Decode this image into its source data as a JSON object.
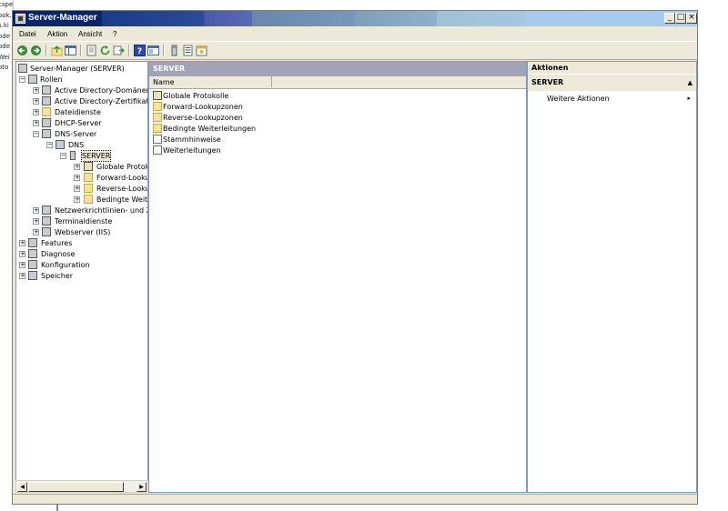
{
  "background": {
    "left_text_lines": [
      "cspeicherte Look",
      "ook.",
      "s.ki",
      "ode",
      "ode",
      "Wei",
      "oto"
    ]
  },
  "window": {
    "title": "Server-Manager",
    "buttons": {
      "minimize": "_",
      "maximize": "□",
      "close": "×"
    }
  },
  "menu": [
    "Datei",
    "Aktion",
    "Ansicht",
    "?"
  ],
  "toolbar": {
    "icons": [
      "back-icon",
      "forward-icon",
      "up-icon",
      "show-hide-tree-icon",
      "export-icon",
      "refresh-icon",
      "export-list-icon",
      "help-icon",
      "properties-icon",
      "server-icon",
      "list-icon",
      "calendar-icon"
    ]
  },
  "tree": {
    "items": [
      {
        "label": "Server-Manager (SERVER)",
        "icon": "server-manager-icon",
        "expander": ""
      },
      {
        "label": "Rollen",
        "icon": "roles-icon",
        "expander": "−"
      },
      {
        "label": "Active Directory-Domänendienste",
        "icon": "ad-icon",
        "expander": "+"
      },
      {
        "label": "Active Directory-Zertifikatdienste",
        "icon": "ad-cert-icon",
        "expander": "+"
      },
      {
        "label": "Dateidienste",
        "icon": "file-services-icon",
        "expander": "+"
      },
      {
        "label": "DHCP-Server",
        "icon": "dhcp-icon",
        "expander": "+"
      },
      {
        "label": "DNS-Server",
        "icon": "dns-server-icon",
        "expander": "−"
      },
      {
        "label": "DNS",
        "icon": "dns-icon",
        "expander": "−"
      },
      {
        "label": "SERVER",
        "icon": "server-icon",
        "expander": "−"
      },
      {
        "label": "Globale Protokolle",
        "icon": "log-icon",
        "expander": "+"
      },
      {
        "label": "Forward-Lookupzonen",
        "icon": "folder-icon",
        "expander": "+"
      },
      {
        "label": "Reverse-Lookupzonen",
        "icon": "folder-icon",
        "expander": "+"
      },
      {
        "label": "Bedingte Weiterleitungen",
        "icon": "folder-icon",
        "expander": "+"
      },
      {
        "label": "Netzwerkrichtlinien- und Zugriffsdienste",
        "icon": "network-policy-icon",
        "expander": "+"
      },
      {
        "label": "Terminaldienste",
        "icon": "terminal-services-icon",
        "expander": "+"
      },
      {
        "label": "Webserver (IIS)",
        "icon": "webserver-icon",
        "expander": "+"
      },
      {
        "label": "Features",
        "icon": "features-icon",
        "expander": "+"
      },
      {
        "label": "Diagnose",
        "icon": "diagnostics-icon",
        "expander": "+"
      },
      {
        "label": "Konfiguration",
        "icon": "configuration-icon",
        "expander": "+"
      },
      {
        "label": "Speicher",
        "icon": "storage-icon",
        "expander": "+"
      }
    ],
    "selected": "SERVER"
  },
  "center": {
    "header": "SERVER",
    "column_header": "Name",
    "rows": [
      {
        "label": "Globale Protokolle",
        "icon": "log-icon"
      },
      {
        "label": "Forward-Lookupzonen",
        "icon": "folder-icon"
      },
      {
        "label": "Reverse-Lookupzonen",
        "icon": "folder-icon"
      },
      {
        "label": "Bedingte Weiterleitungen",
        "icon": "folder-icon"
      },
      {
        "label": "Stammhinweise",
        "icon": "document-icon"
      },
      {
        "label": "Weiterleitungen",
        "icon": "document-icon"
      }
    ]
  },
  "actions": {
    "header": "Aktionen",
    "section": "SERVER",
    "collapse_glyph": "▲",
    "items": [
      {
        "label": "Weitere Aktionen",
        "arrow": "▸"
      }
    ]
  },
  "colors": {
    "title_bar": "#0a246a",
    "window_bg": "#ece9d8",
    "center_header": "#a2a2b8",
    "pane_border": "#7f9db9"
  }
}
